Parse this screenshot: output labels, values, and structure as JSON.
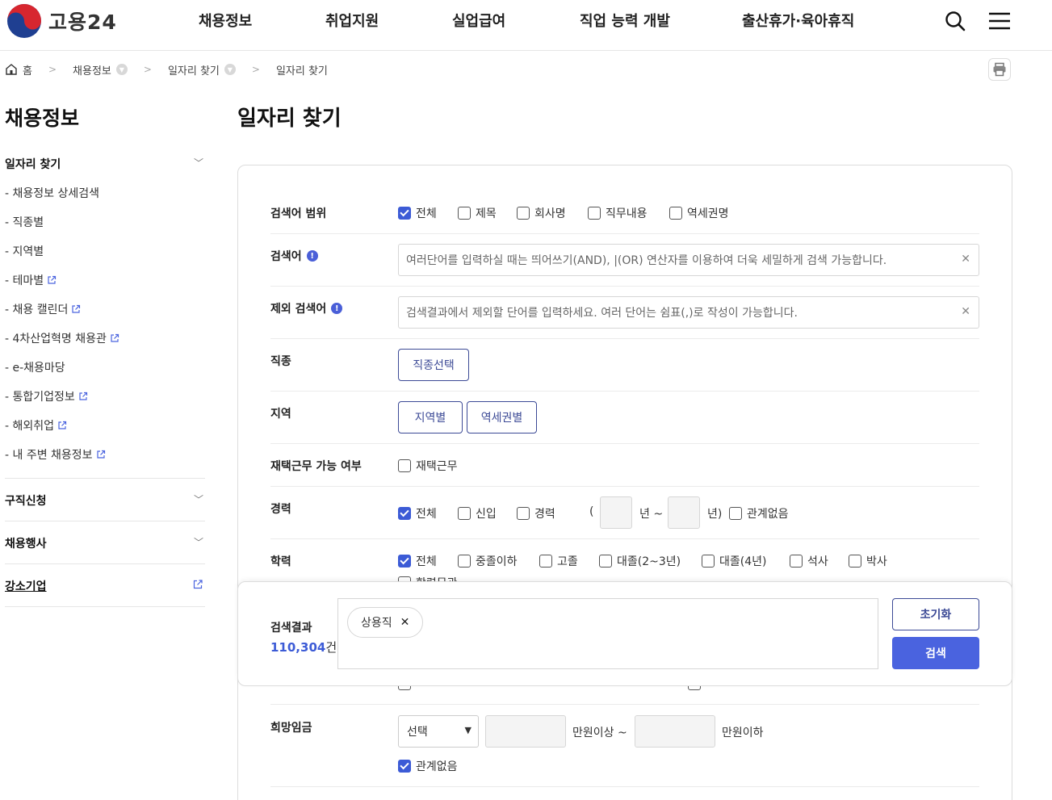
{
  "header": {
    "logo_text": "고용24",
    "nav": [
      "채용정보",
      "취업지원",
      "실업급여",
      "직업 능력 개발",
      "출산휴가·육아휴직"
    ]
  },
  "breadcrumb": {
    "home": "홈",
    "items": [
      "채용정보",
      "일자리 찾기",
      "일자리 찾기"
    ]
  },
  "sidebar": {
    "title": "채용정보",
    "section_main": "일자리 찾기",
    "items": [
      "- 채용정보 상세검색",
      "- 직종별",
      "- 지역별",
      "- 테마별",
      "- 채용 캘린더",
      "- 4차산업혁명 채용관",
      "- e-채용마당",
      "- 통합기업정보",
      "- 해외취업",
      "- 내 주변 채용정보"
    ],
    "sections": [
      "구직신청",
      "채용행사",
      "강소기업"
    ]
  },
  "main": {
    "title": "일자리 찾기",
    "search_scope": {
      "label": "검색어 범위",
      "options": [
        "전체",
        "제목",
        "회사명",
        "직무내용",
        "역세권명"
      ]
    },
    "keyword": {
      "label": "검색어",
      "placeholder": "여러단어를 입력하실 때는 띄어쓰기(AND), |(OR) 연산자를 이용하여 더욱 세밀하게 검색 가능합니다."
    },
    "exclude": {
      "label": "제외 검색어",
      "placeholder": "검색결과에서 제외할 단어를 입력하세요. 여러 단어는 쉼표(,)로 작성이 가능합니다."
    },
    "job_type": {
      "label": "직종",
      "button": "직종선택"
    },
    "region": {
      "label": "지역",
      "buttons": [
        "지역별",
        "역세권별"
      ]
    },
    "remote": {
      "label": "재택근무 가능 여부",
      "option": "재택근무"
    },
    "career": {
      "label": "경력",
      "options": [
        "전체",
        "신입",
        "경력"
      ],
      "open_paren": "(",
      "year_from_unit": "년 ~",
      "year_to_unit": "년)",
      "none": "관계없음"
    },
    "education": {
      "label": "학력",
      "options": [
        "전체",
        "중졸이하",
        "고졸",
        "대졸(2~3년)",
        "대졸(4년)",
        "석사",
        "박사"
      ],
      "partial_option": "학력무관"
    },
    "salary": {
      "label": "희망임금",
      "select": "선택",
      "unit_from": "만원이상 ~",
      "unit_to": "만원이하",
      "none": "관계없음"
    }
  },
  "result_bar": {
    "label": "검색결과",
    "count": "110,304",
    "unit": "건",
    "chip": "상용직",
    "reset": "초기화",
    "search": "검색"
  }
}
